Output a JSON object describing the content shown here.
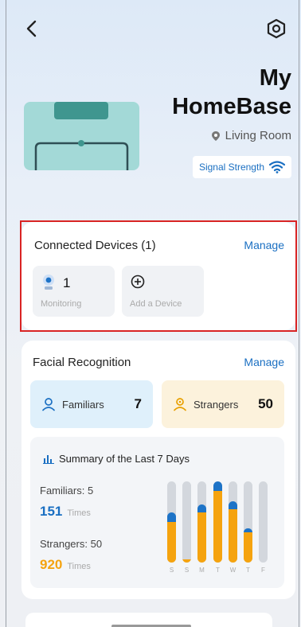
{
  "header": {
    "back_icon": "chevron-left-icon",
    "settings_icon": "settings-hex-icon"
  },
  "device": {
    "title_line1": "My",
    "title_line2": "HomeBase",
    "location": "Living Room",
    "signal_label": "Signal Strength"
  },
  "connected": {
    "title": "Connected Devices (1)",
    "manage": "Manage",
    "monitoring_count": "1",
    "monitoring_label": "Monitoring",
    "add_label": "Add a Device"
  },
  "facial": {
    "title": "Facial Recognition",
    "manage": "Manage",
    "familiars_label": "Familiars",
    "familiars_count": "7",
    "strangers_label": "Strangers",
    "strangers_count": "50",
    "summary_title": "Summary of the Last 7 Days",
    "familiars_summary": "Familiars: 5",
    "familiars_times": "151",
    "strangers_summary": "Strangers: 50",
    "strangers_times": "920",
    "times_label": "Times",
    "chart": {
      "days": [
        "S",
        "S",
        "M",
        "T",
        "W",
        "T",
        "F"
      ],
      "familiars_fraction": [
        0.12,
        0.0,
        0.1,
        0.12,
        0.1,
        0.05,
        0.0
      ],
      "strangers_fraction": [
        0.5,
        0.04,
        0.62,
        0.88,
        0.66,
        0.37,
        0.0
      ]
    }
  },
  "colors": {
    "accent_blue": "#1a6fc2",
    "accent_orange": "#f5a30f",
    "highlight_red": "#d92424"
  }
}
